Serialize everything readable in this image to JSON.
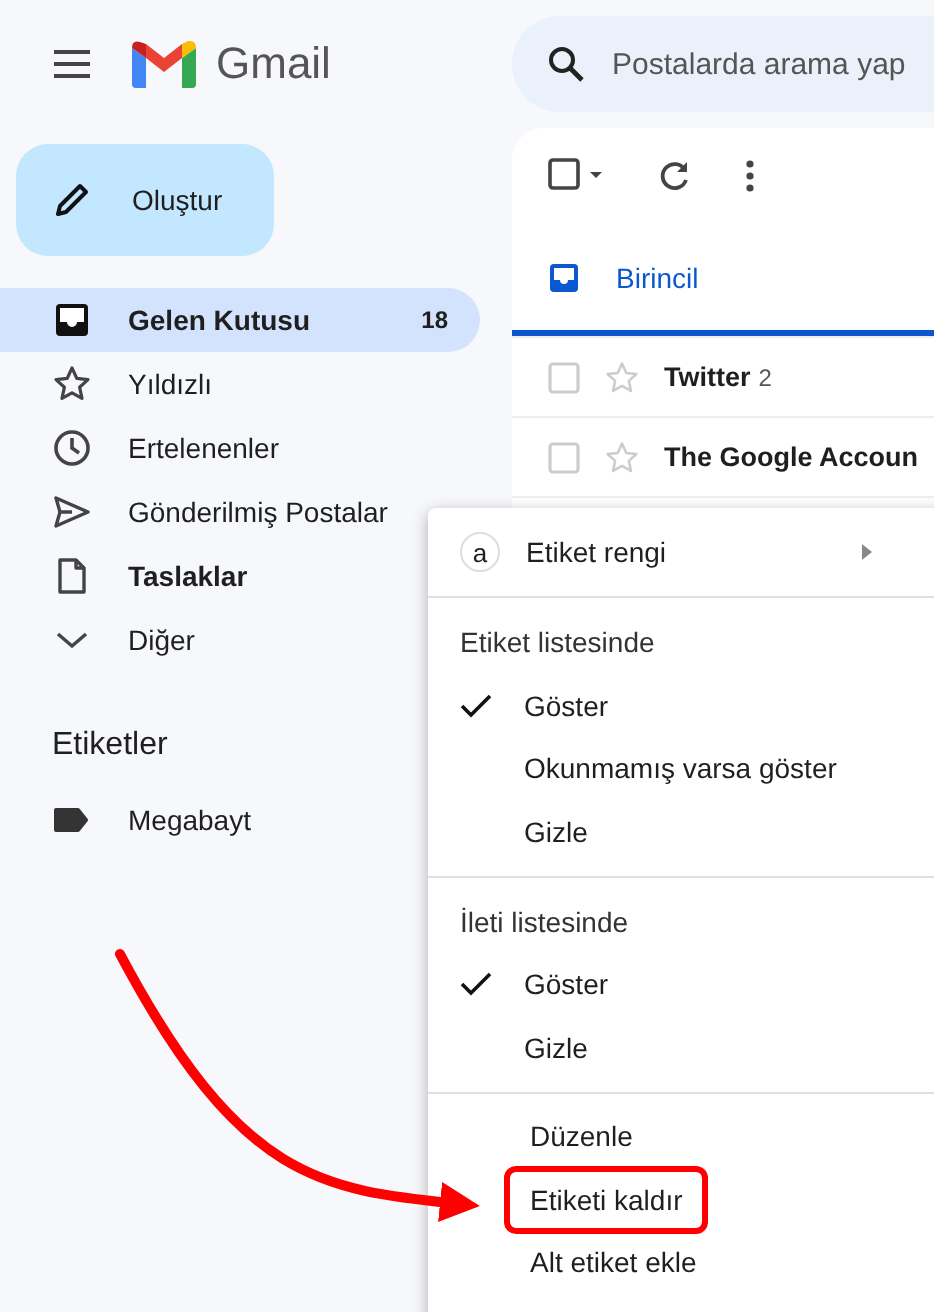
{
  "header": {
    "app_name": "Gmail",
    "search": {
      "placeholder": "Postalarda arama yap"
    }
  },
  "compose_button": {
    "label": "Oluştur"
  },
  "sidebar": {
    "items": [
      {
        "label": "Gelen Kutusu",
        "count": "18",
        "selected": true,
        "bold": true
      },
      {
        "label": "Yıldızlı",
        "selected": false,
        "bold": false
      },
      {
        "label": "Ertelenenler",
        "selected": false,
        "bold": false
      },
      {
        "label": "Gönderilmiş Postalar",
        "selected": false,
        "bold": false
      },
      {
        "label": "Taslaklar",
        "selected": false,
        "bold": true
      },
      {
        "label": "Diğer",
        "selected": false,
        "bold": false
      }
    ],
    "labels_heading": "Etiketler",
    "labels": [
      {
        "label": "Megabayt"
      }
    ]
  },
  "tabs": [
    {
      "label": "Birincil",
      "selected": true
    }
  ],
  "emails": [
    {
      "sender": "Twitter",
      "count": "2",
      "starred": false,
      "unread": true
    },
    {
      "sender": "The Google Accoun",
      "starred": false,
      "unread": true
    }
  ],
  "context_menu": {
    "color_item": {
      "badge": "a",
      "label": "Etiket rengi"
    },
    "sections": [
      {
        "heading": "Etiket listesinde",
        "items": [
          {
            "label": "Göster",
            "checked": true
          },
          {
            "label": "Okunmamış varsa göster",
            "checked": false
          },
          {
            "label": "Gizle",
            "checked": false
          }
        ]
      },
      {
        "heading": "İleti listesinde",
        "items": [
          {
            "label": "Göster",
            "checked": true
          },
          {
            "label": "Gizle",
            "checked": false
          }
        ]
      }
    ],
    "actions": [
      {
        "label": "Düzenle",
        "highlighted": false
      },
      {
        "label": "Etiketi kaldır",
        "highlighted": true
      },
      {
        "label": "Alt etiket ekle",
        "highlighted": false
      }
    ]
  }
}
